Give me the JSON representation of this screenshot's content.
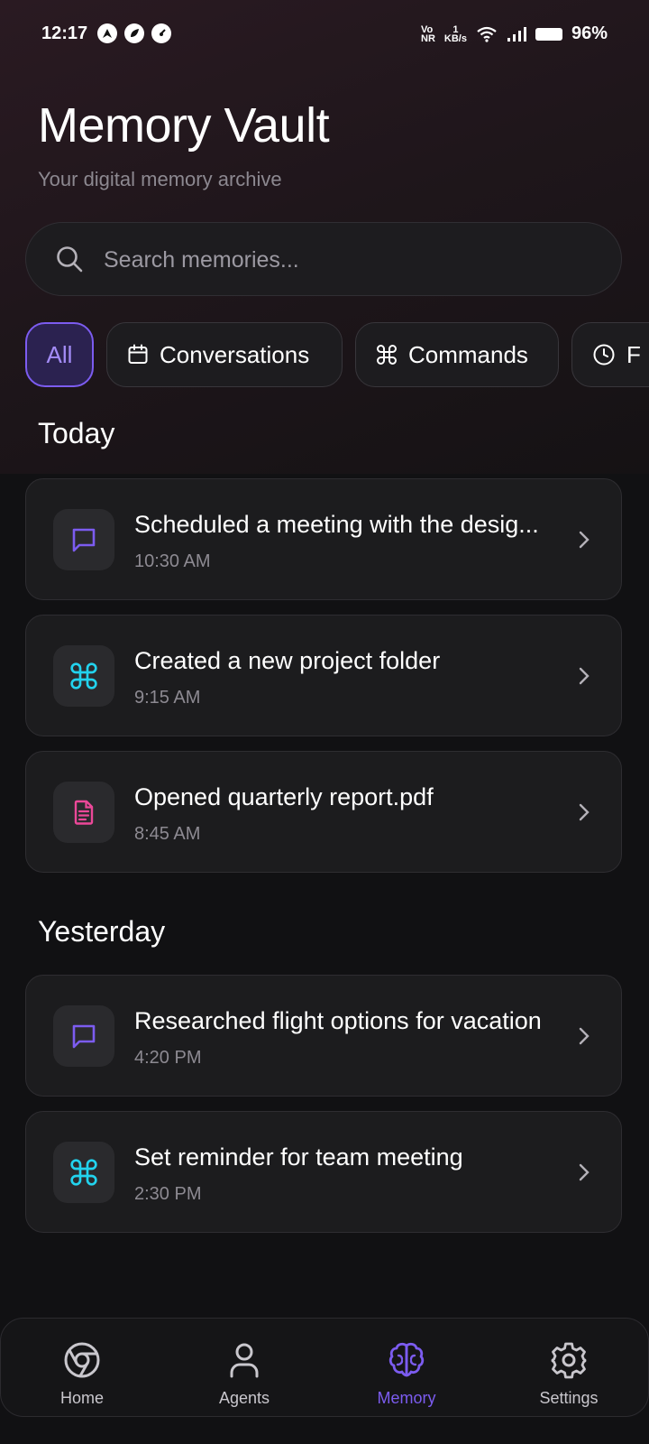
{
  "status_bar": {
    "time": "12:17",
    "network_label_top": "Vo",
    "network_label_bottom": "NR",
    "speed_value": "1",
    "speed_unit": "KB/s",
    "battery": "96%"
  },
  "header": {
    "title": "Memory Vault",
    "subtitle": "Your digital memory archive"
  },
  "search": {
    "placeholder": "Search memories..."
  },
  "filters": [
    {
      "label": "All",
      "icon": "none",
      "active": true
    },
    {
      "label": "Conversations",
      "icon": "calendar-icon",
      "active": false
    },
    {
      "label": "Commands",
      "icon": "command-icon",
      "active": false
    },
    {
      "label": "F",
      "icon": "clock-icon",
      "active": false
    }
  ],
  "sections": [
    {
      "title": "Today",
      "items": [
        {
          "title": "Scheduled a meeting with the desig...",
          "time": "10:30 AM",
          "icon": "chat-icon"
        },
        {
          "title": "Created a new project folder",
          "time": "9:15 AM",
          "icon": "command-icon"
        },
        {
          "title": "Opened quarterly report.pdf",
          "time": "8:45 AM",
          "icon": "document-icon"
        }
      ]
    },
    {
      "title": "Yesterday",
      "items": [
        {
          "title": "Researched flight options for vacation",
          "time": "4:20 PM",
          "icon": "chat-icon"
        },
        {
          "title": "Set reminder for team meeting",
          "time": "2:30 PM",
          "icon": "command-icon"
        }
      ]
    }
  ],
  "bottom_nav": [
    {
      "label": "Home",
      "icon": "chrome-icon",
      "active": false
    },
    {
      "label": "Agents",
      "icon": "person-icon",
      "active": false
    },
    {
      "label": "Memory",
      "icon": "brain-icon",
      "active": true
    },
    {
      "label": "Settings",
      "icon": "gear-icon",
      "active": false
    }
  ],
  "colors": {
    "accent": "#7c5cf0",
    "chat_icon": "#7c5cf0",
    "command_icon": "#22d3ee",
    "document_icon": "#ec4899",
    "background": "#111113"
  }
}
